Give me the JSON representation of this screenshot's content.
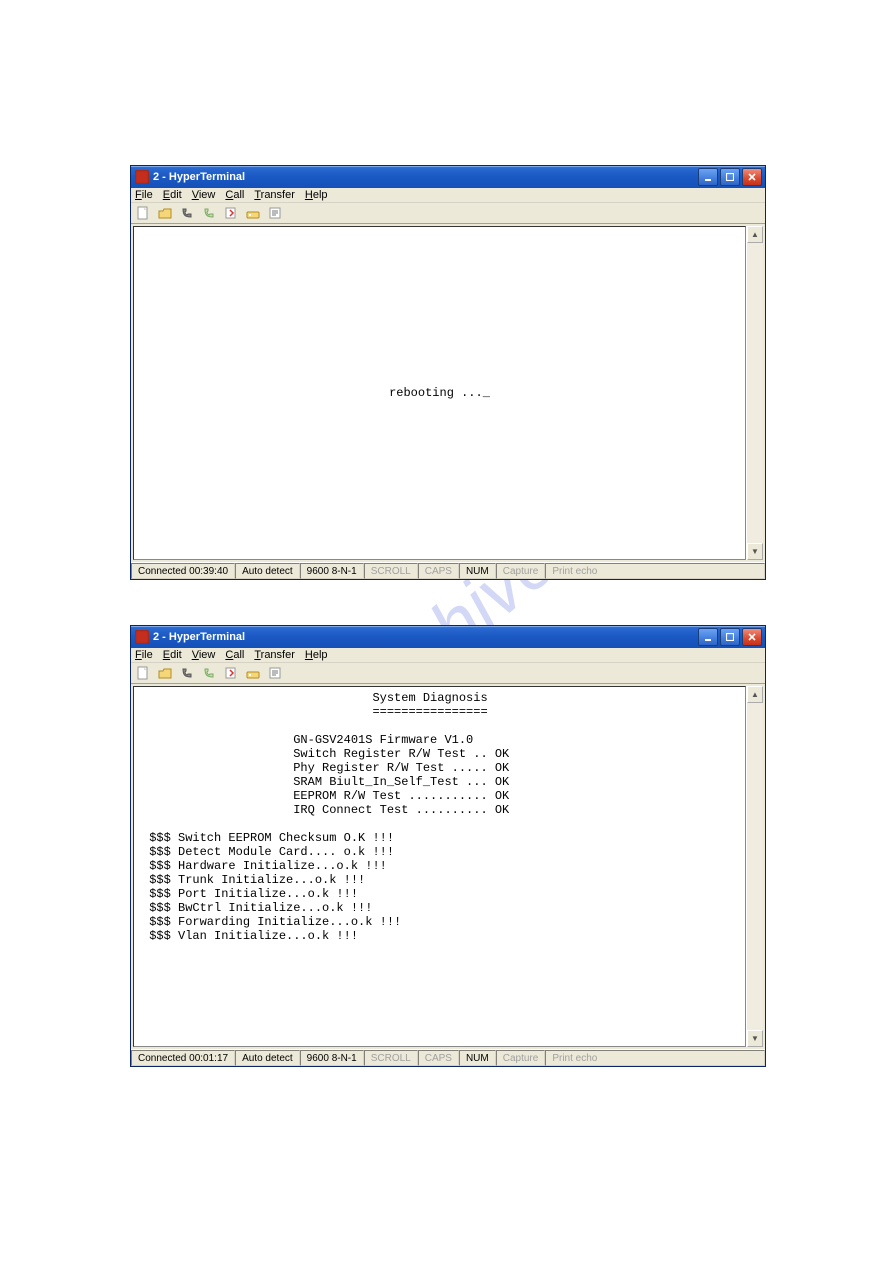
{
  "watermark": "manualshive.com",
  "window1": {
    "title": "2 - HyperTerminal",
    "menu": {
      "items": [
        "File",
        "Edit",
        "View",
        "Call",
        "Transfer",
        "Help"
      ]
    },
    "terminal": {
      "center_text": "rebooting ..._"
    },
    "status": {
      "connected": "Connected 00:39:40",
      "detect": "Auto detect",
      "baud": "9600 8-N-1",
      "scroll": "SCROLL",
      "caps": "CAPS",
      "num": "NUM",
      "capture": "Capture",
      "printecho": "Print echo"
    }
  },
  "window2": {
    "title": "2 - HyperTerminal",
    "menu": {
      "items": [
        "File",
        "Edit",
        "View",
        "Call",
        "Transfer",
        "Help"
      ]
    },
    "terminal": {
      "title": "System Diagnosis",
      "title_underline": "================",
      "block1": [
        "GN-GSV2401S Firmware V1.0",
        "Switch Register R/W Test .. OK",
        "Phy Register R/W Test ..... OK",
        "SRAM Biult_In_Self_Test ... OK",
        "EEPROM R/W Test ........... OK",
        "IRQ Connect Test .......... OK"
      ],
      "block2": [
        "$$$ Switch EEPROM Checksum O.K !!!",
        "$$$ Detect Module Card.... o.k !!!",
        "$$$ Hardware Initialize...o.k !!!",
        "$$$ Trunk Initialize...o.k !!!",
        "$$$ Port Initialize...o.k !!!",
        "$$$ BwCtrl Initialize...o.k !!!",
        "$$$ Forwarding Initialize...o.k !!!",
        "$$$ Vlan Initialize...o.k !!!"
      ]
    },
    "status": {
      "connected": "Connected 00:01:17",
      "detect": "Auto detect",
      "baud": "9600 8-N-1",
      "scroll": "SCROLL",
      "caps": "CAPS",
      "num": "NUM",
      "capture": "Capture",
      "printecho": "Print echo"
    }
  },
  "toolbar_icons": [
    "new-icon",
    "open-icon",
    "call-icon",
    "disconnect-icon",
    "send-icon",
    "receive-icon",
    "properties-icon"
  ]
}
